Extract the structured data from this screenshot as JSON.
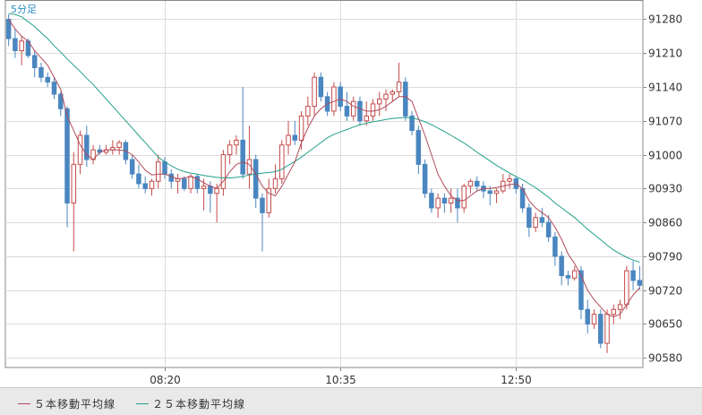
{
  "timeframe_label": "5分足",
  "legend": [
    {
      "label": "５本移動平均線",
      "color": "#b04a5a"
    },
    {
      "label": "２５本移動平均線",
      "color": "#23a08a"
    }
  ],
  "colors": {
    "up": "#c44b4b",
    "down": "#4a86c0",
    "grid": "#dcdcdc",
    "axis": "#888888"
  },
  "chart_data": {
    "type": "candlestick",
    "y_ticks": [
      91280,
      91210,
      91140,
      91070,
      91000,
      90930,
      90860,
      90790,
      90720,
      90650,
      90580
    ],
    "x_ticks": [
      {
        "label": "08:20",
        "index": 24
      },
      {
        "label": "10:35",
        "index": 51
      },
      {
        "label": "12:50",
        "index": 78
      }
    ],
    "ylim": [
      90560,
      91305
    ],
    "ohlc": [
      [
        91280,
        91290,
        91225,
        91240
      ],
      [
        91240,
        91260,
        91200,
        91215
      ],
      [
        91215,
        91245,
        91185,
        91235
      ],
      [
        91235,
        91240,
        91200,
        91205
      ],
      [
        91205,
        91215,
        91160,
        91180
      ],
      [
        91180,
        91190,
        91150,
        91160
      ],
      [
        91160,
        91170,
        91140,
        91150
      ],
      [
        91150,
        91160,
        91115,
        91125
      ],
      [
        91125,
        91130,
        91080,
        91095
      ],
      [
        91095,
        91100,
        90850,
        90900
      ],
      [
        90900,
        91005,
        90800,
        90980
      ],
      [
        90980,
        91050,
        90960,
        91040
      ],
      [
        91040,
        91060,
        90975,
        90990
      ],
      [
        90990,
        91020,
        90980,
        91010
      ],
      [
        91010,
        91020,
        91000,
        91005
      ],
      [
        91005,
        91020,
        91000,
        91010
      ],
      [
        91010,
        91030,
        91000,
        91015
      ],
      [
        91015,
        91030,
        91000,
        91025
      ],
      [
        91025,
        91030,
        90980,
        90990
      ],
      [
        90990,
        91000,
        90950,
        90960
      ],
      [
        90960,
        90980,
        90930,
        90940
      ],
      [
        90940,
        90955,
        90920,
        90930
      ],
      [
        90930,
        90950,
        90915,
        90945
      ],
      [
        90945,
        91000,
        90930,
        90985
      ],
      [
        90985,
        90995,
        90950,
        90960
      ],
      [
        90960,
        90970,
        90930,
        90945
      ],
      [
        90945,
        90960,
        90920,
        90950
      ],
      [
        90950,
        90955,
        90925,
        90930
      ],
      [
        90930,
        90960,
        90920,
        90955
      ],
      [
        90955,
        90960,
        90920,
        90930
      ],
      [
        90930,
        90950,
        90885,
        90935
      ],
      [
        90935,
        90945,
        90880,
        90920
      ],
      [
        90920,
        90940,
        90860,
        90930
      ],
      [
        90930,
        91010,
        90915,
        91000
      ],
      [
        91000,
        91030,
        90980,
        91020
      ],
      [
        91020,
        91040,
        91000,
        91030
      ],
      [
        91030,
        91140,
        90950,
        90960
      ],
      [
        90960,
        91060,
        90930,
        90990
      ],
      [
        90990,
        91000,
        90890,
        90910
      ],
      [
        90910,
        90920,
        90800,
        90880
      ],
      [
        90880,
        90950,
        90870,
        90930
      ],
      [
        90930,
        90980,
        90920,
        90950
      ],
      [
        90950,
        91030,
        90940,
        91020
      ],
      [
        91020,
        91070,
        91000,
        91040
      ],
      [
        91040,
        91070,
        91020,
        91030
      ],
      [
        91030,
        91090,
        91010,
        91080
      ],
      [
        91080,
        91120,
        91060,
        91100
      ],
      [
        91100,
        91170,
        91080,
        91160
      ],
      [
        91160,
        91170,
        91110,
        91120
      ],
      [
        91120,
        91130,
        91080,
        91090
      ],
      [
        91090,
        91150,
        91080,
        91140
      ],
      [
        91140,
        91150,
        91090,
        91100
      ],
      [
        91100,
        91130,
        91070,
        91080
      ],
      [
        91080,
        91120,
        91070,
        91110
      ],
      [
        91110,
        91120,
        91060,
        91070
      ],
      [
        91070,
        91110,
        91060,
        91080
      ],
      [
        91080,
        91115,
        91070,
        91105
      ],
      [
        91105,
        91130,
        91080,
        91115
      ],
      [
        91115,
        91135,
        91090,
        91125
      ],
      [
        91125,
        91135,
        91110,
        91130
      ],
      [
        91130,
        91190,
        91120,
        91150
      ],
      [
        91150,
        91160,
        91070,
        91080
      ],
      [
        91080,
        91090,
        91040,
        91050
      ],
      [
        91050,
        91060,
        90960,
        90980
      ],
      [
        90980,
        90990,
        90910,
        90920
      ],
      [
        90920,
        90930,
        90880,
        90890
      ],
      [
        90890,
        90920,
        90870,
        90910
      ],
      [
        90910,
        90920,
        90880,
        90900
      ],
      [
        90900,
        90930,
        90880,
        90910
      ],
      [
        90910,
        90930,
        90860,
        90890
      ],
      [
        90890,
        90940,
        90880,
        90935
      ],
      [
        90935,
        90950,
        90920,
        90945
      ],
      [
        90945,
        90955,
        90925,
        90935
      ],
      [
        90935,
        90945,
        90910,
        90925
      ],
      [
        90925,
        90935,
        90895,
        90920
      ],
      [
        90920,
        90930,
        90900,
        90925
      ],
      [
        90925,
        90960,
        90920,
        90945
      ],
      [
        90945,
        90960,
        90930,
        90950
      ],
      [
        90950,
        90955,
        90920,
        90930
      ],
      [
        90930,
        90940,
        90880,
        90890
      ],
      [
        90890,
        90900,
        90830,
        90850
      ],
      [
        90850,
        90880,
        90840,
        90870
      ],
      [
        90870,
        90890,
        90850,
        90860
      ],
      [
        90860,
        90875,
        90820,
        90830
      ],
      [
        90830,
        90840,
        90770,
        90790
      ],
      [
        90790,
        90800,
        90730,
        90750
      ],
      [
        90750,
        90760,
        90730,
        90745
      ],
      [
        90745,
        90770,
        90740,
        90760
      ],
      [
        90760,
        90770,
        90660,
        90680
      ],
      [
        90680,
        90700,
        90630,
        90650
      ],
      [
        90650,
        90680,
        90640,
        90670
      ],
      [
        90670,
        90680,
        90600,
        90610
      ],
      [
        90610,
        90680,
        90590,
        90670
      ],
      [
        90670,
        90690,
        90650,
        90680
      ],
      [
        90680,
        90700,
        90660,
        90690
      ],
      [
        90690,
        90770,
        90680,
        90760
      ],
      [
        90760,
        90780,
        90720,
        90740
      ],
      [
        90740,
        90770,
        90720,
        90730
      ]
    ],
    "ma5": [
      91280,
      91260,
      91245,
      91235,
      91215,
      91200,
      91185,
      91160,
      91135,
      91080,
      91050,
      91020,
      91000,
      90990,
      91005,
      91010,
      91010,
      91010,
      91008,
      91000,
      90985,
      90968,
      90958,
      90960,
      90960,
      90955,
      90950,
      90952,
      90955,
      90950,
      90942,
      90935,
      90930,
      90945,
      90965,
      90980,
      90985,
      90980,
      90960,
      90935,
      90920,
      90915,
      90935,
      90960,
      90985,
      91025,
      91055,
      91080,
      91095,
      91105,
      91110,
      91115,
      91110,
      91100,
      91095,
      91090,
      91090,
      91093,
      91100,
      91110,
      91120,
      91120,
      91110,
      91075,
      91040,
      91000,
      90960,
      90935,
      90915,
      90905,
      90905,
      90915,
      90925,
      90930,
      90930,
      90932,
      90935,
      90938,
      90940,
      90930,
      90905,
      90890,
      90880,
      90870,
      90850,
      90825,
      90795,
      90775,
      90750,
      90720,
      90700,
      90685,
      90670,
      90665,
      90670,
      90690,
      90710,
      90725
    ]
  },
  "ma25_points": [
    91292,
    91290,
    91285,
    91275,
    91265,
    91252,
    91240,
    91225,
    91212,
    91198,
    91185,
    91172,
    91158,
    91145,
    91130,
    91115,
    91100,
    91085,
    91070,
    91055,
    91040,
    91025,
    91010,
    90995,
    90985,
    90977,
    90970,
    90965,
    90962,
    90960,
    90957,
    90955,
    90953,
    90952,
    90952,
    90953,
    90955,
    90958,
    90960,
    90962,
    90963,
    90965,
    90970,
    90978,
    90986,
    90995,
    91005,
    91015,
    91025,
    91035,
    91042,
    91047,
    91052,
    91057,
    91062,
    91065,
    91068,
    91070,
    91073,
    91075,
    91076,
    91077,
    91076,
    91073,
    91068,
    91062,
    91055,
    91048,
    91040,
    91032,
    91024,
    91015,
    91005,
    90996,
    90987,
    90978,
    90970,
    90962,
    90955,
    90948,
    90940,
    90932,
    90922,
    90912,
    90900,
    90890,
    90880,
    90870,
    90858,
    90846,
    90835,
    90824,
    90813,
    90803,
    90795,
    90788,
    90782,
    90778
  ]
}
